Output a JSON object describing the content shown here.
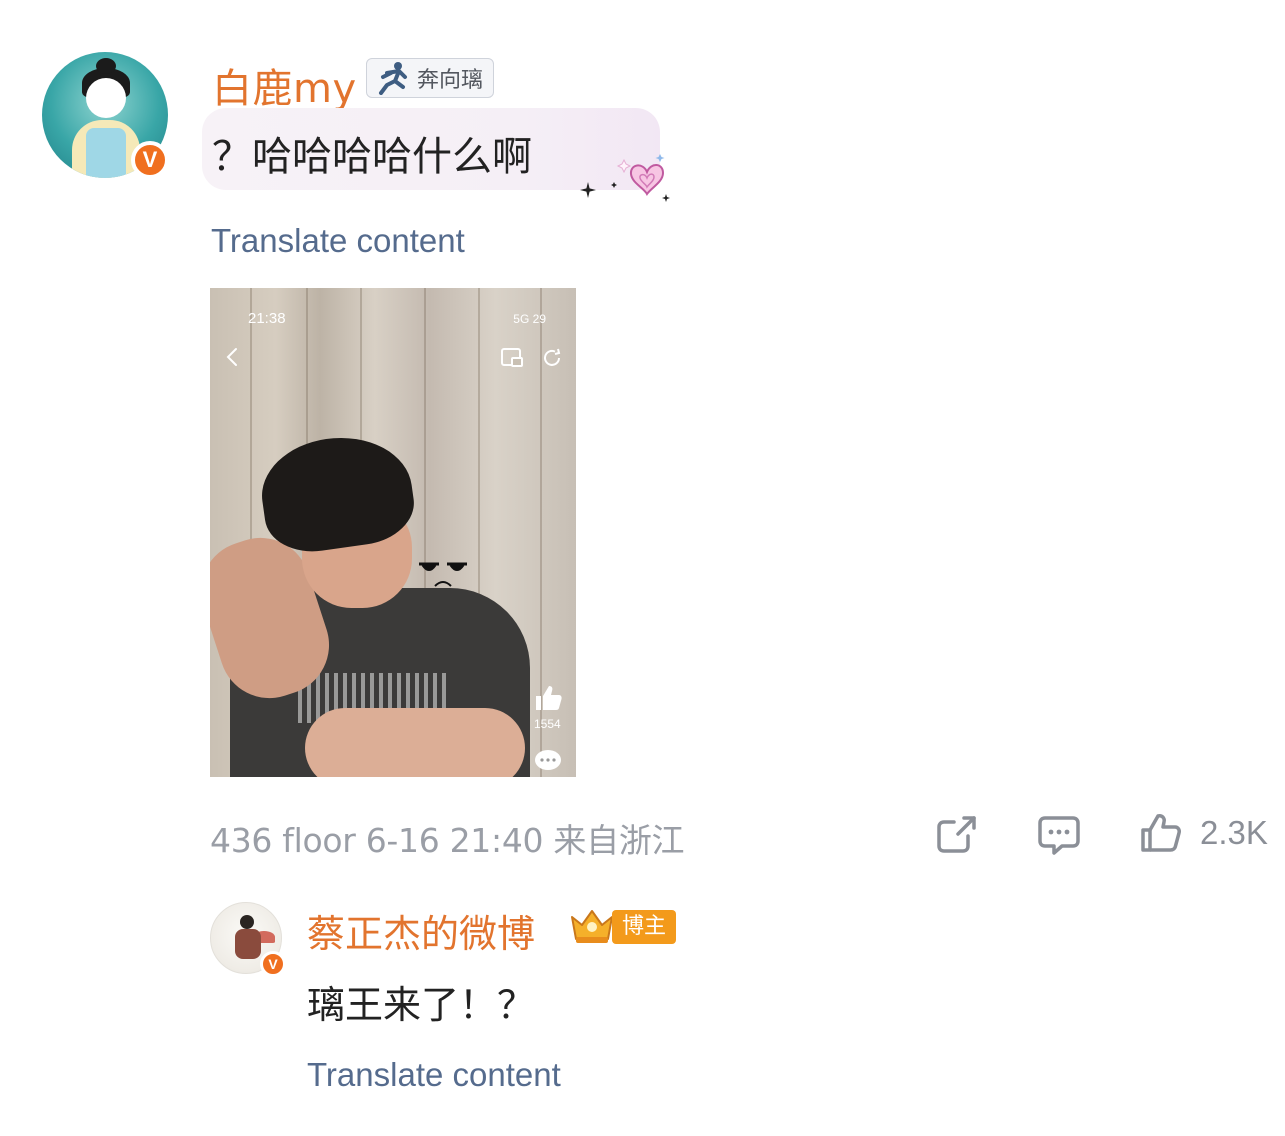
{
  "main_comment": {
    "username": "白鹿my",
    "tag_label": "奔向璃",
    "verified_mark": "V",
    "text": "？哈哈哈哈什么啊",
    "translate_label": "Translate content",
    "attachment": {
      "status_time": "21:38",
      "status_network": "5G  29",
      "like_count": "1554"
    },
    "meta": {
      "floor": "436 floor",
      "date": "6-16 21:40",
      "location": "来自浙江"
    },
    "actions": {
      "like_count": "2.3K"
    }
  },
  "reply": {
    "username": "蔡正杰的微博",
    "badge_label": "博主",
    "verified_mark": "V",
    "text": "璃王来了！？",
    "translate_label": "Translate content"
  },
  "colors": {
    "username": "#e2742e",
    "link": "#556b8d",
    "meta": "#9a9ea6",
    "verified": "#f06f1f",
    "host_badge": "#f39a1b"
  },
  "icons": [
    "runner-icon",
    "heart-icon",
    "sparkle-icon",
    "share-icon",
    "comment-icon",
    "like-icon",
    "crown-icon"
  ]
}
